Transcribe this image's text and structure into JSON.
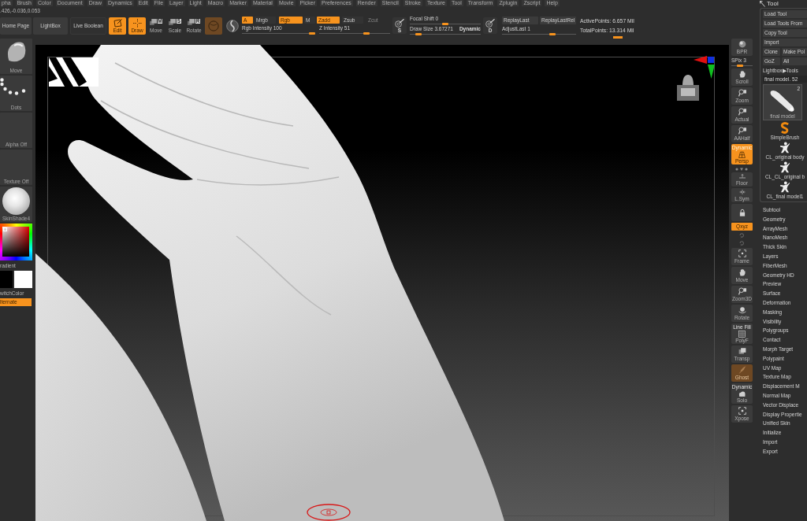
{
  "menu_bar": [
    "pha",
    "Brush",
    "Color",
    "Document",
    "Draw",
    "Dynamics",
    "Edit",
    "File",
    "Layer",
    "Light",
    "Macro",
    "Marker",
    "Material",
    "Movie",
    "Picker",
    "Preferences",
    "Render",
    "Stencil",
    "Stroke",
    "Texture",
    "Tool",
    "Transform",
    "Zplugin",
    "Zscript",
    "Help"
  ],
  "coordinates": ".426,-0.036,0.053",
  "toolbar": {
    "buttons": [
      "Home Page",
      "LightBox",
      "Live Boolean"
    ],
    "modes": [
      {
        "label": "Edit",
        "selected": true
      },
      {
        "label": "Draw",
        "selected": true
      },
      {
        "label": "Move",
        "glyph": "M",
        "selected": false
      },
      {
        "label": "Scale",
        "glyph": "S",
        "selected": false
      },
      {
        "label": "Rotate",
        "glyph": "R",
        "selected": false
      }
    ],
    "channels": [
      {
        "label": "A",
        "on": true,
        "disabled": false
      },
      {
        "label": "Mrgb",
        "on": false,
        "disabled": false
      },
      {
        "label": "Rgb",
        "on": true,
        "disabled": false
      },
      {
        "label": "M",
        "on": false,
        "disabled": false
      },
      {
        "label": "Zadd",
        "on": true,
        "disabled": false
      },
      {
        "label": "Zsub",
        "on": false,
        "disabled": false
      },
      {
        "label": "Zcut",
        "on": false,
        "disabled": true
      }
    ],
    "intensity_sliders": [
      {
        "label": "Rgb Intensity 100",
        "level": 1
      },
      {
        "label": "Z Intensity 51",
        "level": 0.68
      }
    ],
    "focal_button": {
      "glyph": "S"
    },
    "stroke_sliders": [
      {
        "label": "Focal Shift 0",
        "level": 0.5
      },
      {
        "label": "Draw Size 3.67271",
        "badge": "Dynamic",
        "level": 0.08
      }
    ],
    "replay_button": {
      "glyph": "D"
    },
    "replay_buttons": [
      "ReplayLast",
      "ReplayLastRel"
    ],
    "adjust_slider": {
      "label": "AdjustLast 1",
      "level": 0.7
    },
    "stats": [
      "ActivePoints: 6.657 Mil",
      "TotalPoints: 13.314 Mil"
    ]
  },
  "left_shelf": {
    "tiles": [
      {
        "kind": "brush",
        "label": "Move"
      },
      {
        "kind": "stroke",
        "label": "Dots"
      },
      {
        "kind": "alpha",
        "label": "Alpha Off"
      },
      {
        "kind": "texture",
        "label": "Texture Off"
      },
      {
        "kind": "material",
        "label": "SkinShade4"
      }
    ],
    "gradient_label": "radient",
    "swatches": [
      {
        "color": "#000000"
      },
      {
        "color": "#ffffff"
      }
    ],
    "switch_label": "witchColor",
    "alternate": {
      "label": "lternate",
      "on": true
    }
  },
  "view_controls": [
    {
      "kind": "button",
      "label": "BPR",
      "on": false,
      "disabled": false
    },
    {
      "kind": "slider",
      "label": "SPix 3",
      "level": 0.35
    },
    {
      "kind": "button",
      "label": "Scroll",
      "on": false,
      "disabled": false
    },
    {
      "kind": "button",
      "label": "Zoom",
      "on": false,
      "disabled": false
    },
    {
      "kind": "button",
      "label": "Actual",
      "on": false,
      "disabled": false
    },
    {
      "kind": "button",
      "label": "AAHalf",
      "on": false,
      "disabled": false
    },
    {
      "kind": "button",
      "label": "Persp",
      "badge": "Dynamic",
      "on": true,
      "disabled": false
    },
    {
      "kind": "mini",
      "on": false
    },
    {
      "kind": "button",
      "label": "Floor",
      "on": false,
      "disabled": false
    },
    {
      "kind": "button",
      "label": "L.Sym",
      "on": false,
      "disabled": false
    },
    {
      "kind": "button",
      "on": false,
      "disabled": false
    },
    {
      "kind": "toggle",
      "label": "Qxyz",
      "on": true
    },
    {
      "kind": "mini",
      "on": false
    },
    {
      "kind": "mini",
      "on": false
    },
    {
      "kind": "button",
      "label": "Frame",
      "on": false,
      "disabled": false
    },
    {
      "kind": "button",
      "label": "Move",
      "on": false,
      "disabled": false
    },
    {
      "kind": "button",
      "label": "Zoom3D",
      "on": false,
      "disabled": false
    },
    {
      "kind": "button",
      "label": "Rotate",
      "on": false,
      "disabled": false
    },
    {
      "kind": "button",
      "label": "PolyF",
      "badge": "Line Fill",
      "on": false,
      "disabled": false
    },
    {
      "kind": "button",
      "label": "Transp",
      "on": false,
      "disabled": false
    },
    {
      "kind": "button",
      "label": "Ghost",
      "on": true,
      "disabled": true
    },
    {
      "kind": "button",
      "label": "Solo",
      "badge": "Dynamic",
      "on": false,
      "disabled": false
    },
    {
      "kind": "button",
      "label": "Xpose",
      "on": false,
      "disabled": false
    }
  ],
  "tool_panel": {
    "title": "Tool",
    "button_rows": [
      [
        "Load Tool"
      ],
      [
        "Load Tools From"
      ],
      [
        "Copy Tool"
      ],
      [
        "Import"
      ],
      [
        "Clone",
        "Make Pol"
      ],
      [
        "GoZ",
        "All"
      ]
    ],
    "lightbox_link": "Lightbox▶Tools",
    "tool_name": "final model. 52",
    "current_tool": {
      "label": "final model",
      "count": "2"
    },
    "tools": [
      {
        "kind": "brush",
        "label": "SimpleBrush"
      },
      {
        "kind": "mesh",
        "label": "CL_original body"
      },
      {
        "kind": "mesh",
        "label": "CL_CL_original b"
      },
      {
        "kind": "mesh",
        "label": "CL_final model1"
      }
    ],
    "sections": [
      "Subtool",
      "Geometry",
      "ArrayMesh",
      "NanoMesh",
      "Thick Skin",
      "Layers",
      "FiberMesh",
      "Geometry HD",
      "Preview",
      "Surface",
      "Deformation",
      "Masking",
      "Visibility",
      "Polygroups",
      "Contact",
      "Morph Target",
      "Polypaint",
      "UV Map",
      "Texture Map",
      "Displacement M",
      "Normal Map",
      "Vector Displace",
      "Display Propertie",
      "Unified Skin",
      "Initialize",
      "Import",
      "Export"
    ]
  }
}
